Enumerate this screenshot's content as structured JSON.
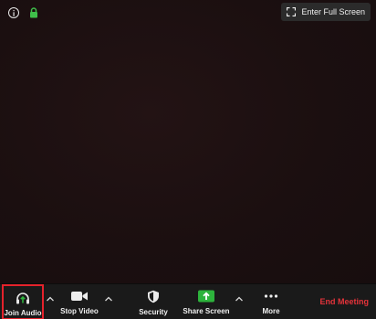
{
  "window": {
    "fullscreen_label": "Enter Full Screen"
  },
  "toolbar": {
    "join_audio": "Join Audio",
    "stop_video": "Stop Video",
    "security": "Security",
    "share_screen": "Share Screen",
    "more": "More",
    "end_meeting": "End Meeting"
  },
  "colors": {
    "highlight": "#e5222b",
    "end_meeting": "#e5333a",
    "share_green": "#2db33c",
    "lock_green": "#3fbf4a"
  }
}
